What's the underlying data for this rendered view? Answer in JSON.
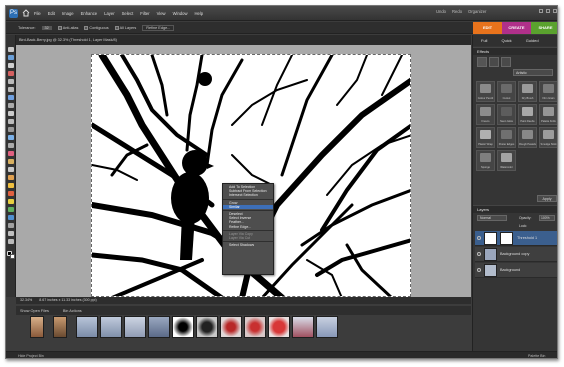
{
  "menu": {
    "items": [
      "File",
      "Edit",
      "Image",
      "Enhance",
      "Layer",
      "Select",
      "Filter",
      "View",
      "Window",
      "Help"
    ]
  },
  "modes": {
    "items": [
      "Undo",
      "Redo",
      "Organizer"
    ]
  },
  "options": {
    "tolerance_label": "Tolerance:",
    "tolerance_value": "32",
    "antialias": "Anti-alias",
    "contiguous": "Contiguous",
    "all_layers": "All Layers",
    "refine": "Refine Edge..."
  },
  "tabs": {
    "edit": "EDIT",
    "create": "CREATE",
    "share": "SHARE"
  },
  "subtabs": {
    "items": [
      "Full",
      "Quick",
      "Guided"
    ]
  },
  "document": {
    "title": "Bird-Back-Berry.jpg @ 32.3% (Threshold 1, Layer Mask/8)"
  },
  "context_menu": [
    {
      "label": "Add To Selection",
      "state": "normal"
    },
    {
      "label": "Subtract From Selection",
      "state": "normal"
    },
    {
      "label": "Intersect Selection",
      "state": "normal"
    },
    {
      "sep": true
    },
    {
      "label": "Grow",
      "state": "normal"
    },
    {
      "label": "Similar",
      "state": "highlight"
    },
    {
      "sep": true
    },
    {
      "label": "Deselect",
      "state": "normal"
    },
    {
      "label": "Select Inverse",
      "state": "normal"
    },
    {
      "label": "Feather...",
      "state": "normal"
    },
    {
      "label": "Refine Edge...",
      "state": "normal"
    },
    {
      "sep": true
    },
    {
      "label": "Layer Via Copy",
      "state": "disabled"
    },
    {
      "label": "Layer Via Cut",
      "state": "disabled"
    },
    {
      "sep": true
    },
    {
      "label": "Select Shadows",
      "state": "normal"
    }
  ],
  "status": {
    "zoom": "32.34%",
    "size": "8.67 inches x 11.33 inches (300 ppi)"
  },
  "bin": {
    "show_open": "Show Open Files",
    "actions": "Bin Actions"
  },
  "effects": {
    "title": "Effects",
    "filter_value": "Artistic",
    "apply_label": "Apply",
    "items": [
      "Colour Pencil",
      "Cutout",
      "Dry Brush",
      "Film Grain",
      "Fresco",
      "Neon Glow",
      "Paint Daubs",
      "Palette Knife",
      "Plastic Wrap",
      "Poster Edges",
      "Rough Pastels",
      "Smudge Stick",
      "Sponge",
      "Watercolor"
    ]
  },
  "layers": {
    "title": "Layers",
    "mode": "Normal",
    "opacity_label": "Opacity:",
    "opacity_value": "100%",
    "lock_label": "Lock:",
    "rows": [
      {
        "name": "Threshold 1"
      },
      {
        "name": "Background copy"
      },
      {
        "name": "Background"
      }
    ]
  },
  "bottom": {
    "left": "Hide Project Bin",
    "right": "Palette Bin"
  },
  "colors": {
    "edit": "#e8731c",
    "create": "#b0308a",
    "share": "#5aa22e",
    "accent": "#3d6fb8"
  }
}
